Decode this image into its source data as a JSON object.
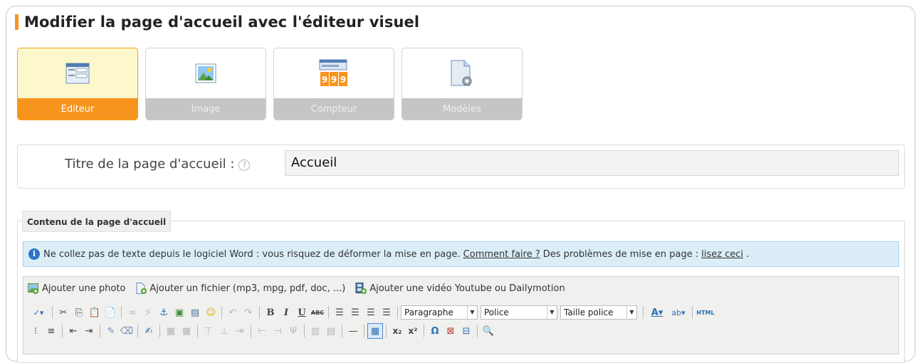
{
  "page": {
    "title": "Modifier la page d'accueil avec l'éditeur visuel",
    "accent": "#f7941d"
  },
  "tabs": [
    {
      "label": "Editeur",
      "icon": "editor-window-icon",
      "active": true
    },
    {
      "label": "Image",
      "icon": "image-icon",
      "active": false
    },
    {
      "label": "Compteur",
      "icon": "counter-icon",
      "active": false
    },
    {
      "label": "Modèles",
      "icon": "template-settings-icon",
      "active": false
    }
  ],
  "home_title": {
    "label": "Titre de la page d'accueil :",
    "help": "?",
    "value": "Accueil"
  },
  "content": {
    "legend": "Contenu de la page d'accueil",
    "info": {
      "text_before": "Ne collez pas de texte depuis le logiciel Word : vous risquez de déformer la mise en page.",
      "link1": "Comment faire ?",
      "text_middle": "Des problèmes de mise en page :",
      "link2": "lisez ceci",
      "text_after": "."
    },
    "media": [
      {
        "label": "Ajouter une photo",
        "icon": "add-photo-icon"
      },
      {
        "label": "Ajouter un fichier (mp3, mpg, pdf, doc, ...)",
        "icon": "add-file-icon"
      },
      {
        "label": "Ajouter une vidéo Youtube ou Dailymotion",
        "icon": "add-video-icon"
      }
    ],
    "dropdowns": {
      "format": "Paragraphe",
      "font": "Police",
      "size": "Taille police"
    },
    "html_label": "HTML"
  }
}
